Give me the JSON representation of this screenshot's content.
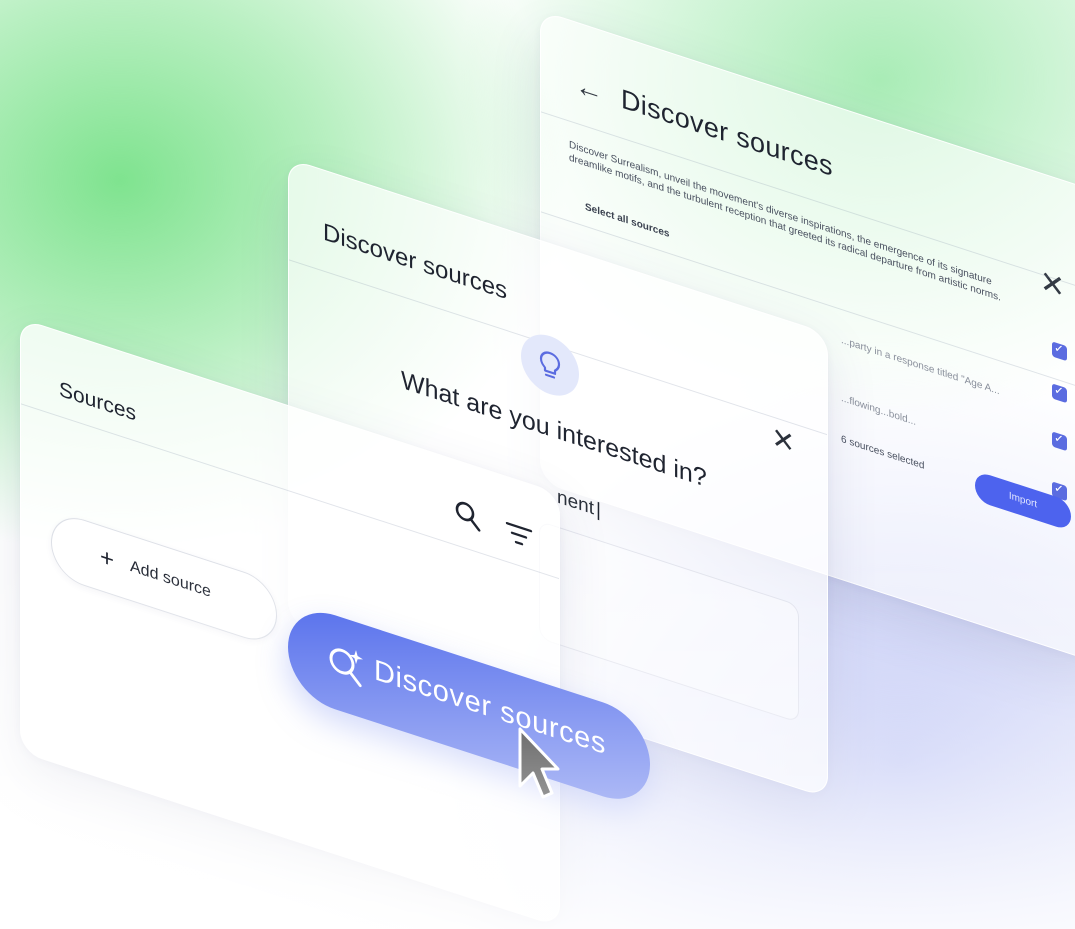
{
  "back_dialog": {
    "title": "Discover sources",
    "description": "Discover Surrealism, unveil the movement's diverse inspirations, the emergence of its signature dreamlike motifs, and the turbulent reception that greeted its radical departure from artistic norms.",
    "select_all": "Select all sources",
    "snippets": [
      "...party in a response titled \"Age A...",
      "...flowing...bold..."
    ],
    "selected_count": "6 sources selected",
    "import_label": "Import"
  },
  "mid_dialog": {
    "title": "Discover sources",
    "question": "What are you interested in?",
    "typed_value": "nent"
  },
  "sources_panel": {
    "title": "Sources",
    "add_source_label": "Add source"
  },
  "cta": {
    "label": "Discover sources",
    "color": "#4561ea"
  },
  "icons": [
    "back-arrow-icon",
    "close-icon",
    "checkbox-icon",
    "lightbulb-icon",
    "search-icon",
    "filter-icon",
    "plus-icon",
    "magic-search-icon",
    "cursor-icon"
  ]
}
